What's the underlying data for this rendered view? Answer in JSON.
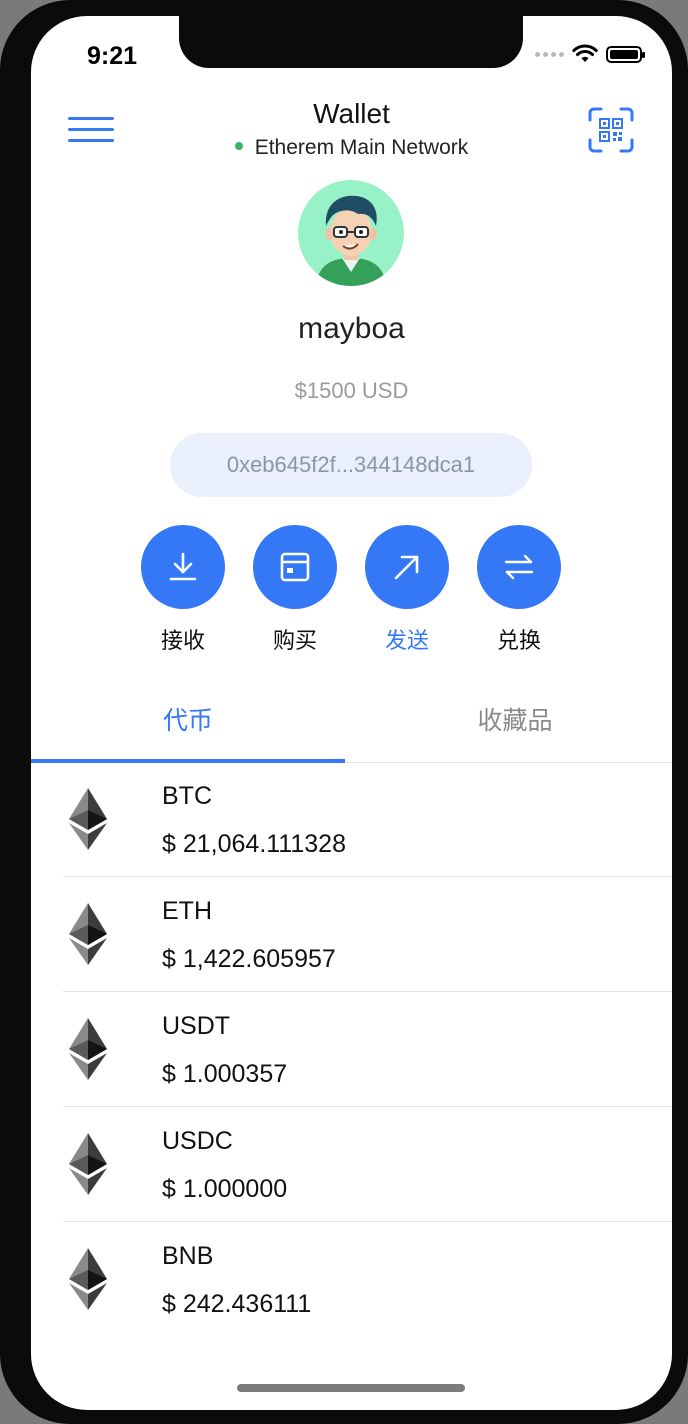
{
  "status_bar": {
    "time": "9:21"
  },
  "header": {
    "title": "Wallet",
    "network": "Etherem Main Network",
    "network_status_color": "#3bb26a"
  },
  "profile": {
    "username": "mayboa",
    "balance": "$1500 USD",
    "address": "0xeb645f2f...344148dca1"
  },
  "actions": [
    {
      "label": "接收",
      "icon": "download-icon"
    },
    {
      "label": "购买",
      "icon": "card-icon"
    },
    {
      "label": "发送",
      "icon": "arrow-up-right-icon"
    },
    {
      "label": "兑换",
      "icon": "swap-icon"
    }
  ],
  "tabs": {
    "tokens": "代币",
    "collectibles": "收藏品",
    "active": "tokens"
  },
  "tokens": [
    {
      "symbol": "BTC",
      "price": "$ 21,064.111328"
    },
    {
      "symbol": "ETH",
      "price": "$ 1,422.605957"
    },
    {
      "symbol": "USDT",
      "price": "$ 1.000357"
    },
    {
      "symbol": "USDC",
      "price": "$ 1.000000"
    },
    {
      "symbol": "BNB",
      "price": "$ 242.436111"
    }
  ],
  "colors": {
    "accent": "#3478f6",
    "address_bg": "#e9f0fb",
    "muted_text": "#9a9a9a"
  }
}
